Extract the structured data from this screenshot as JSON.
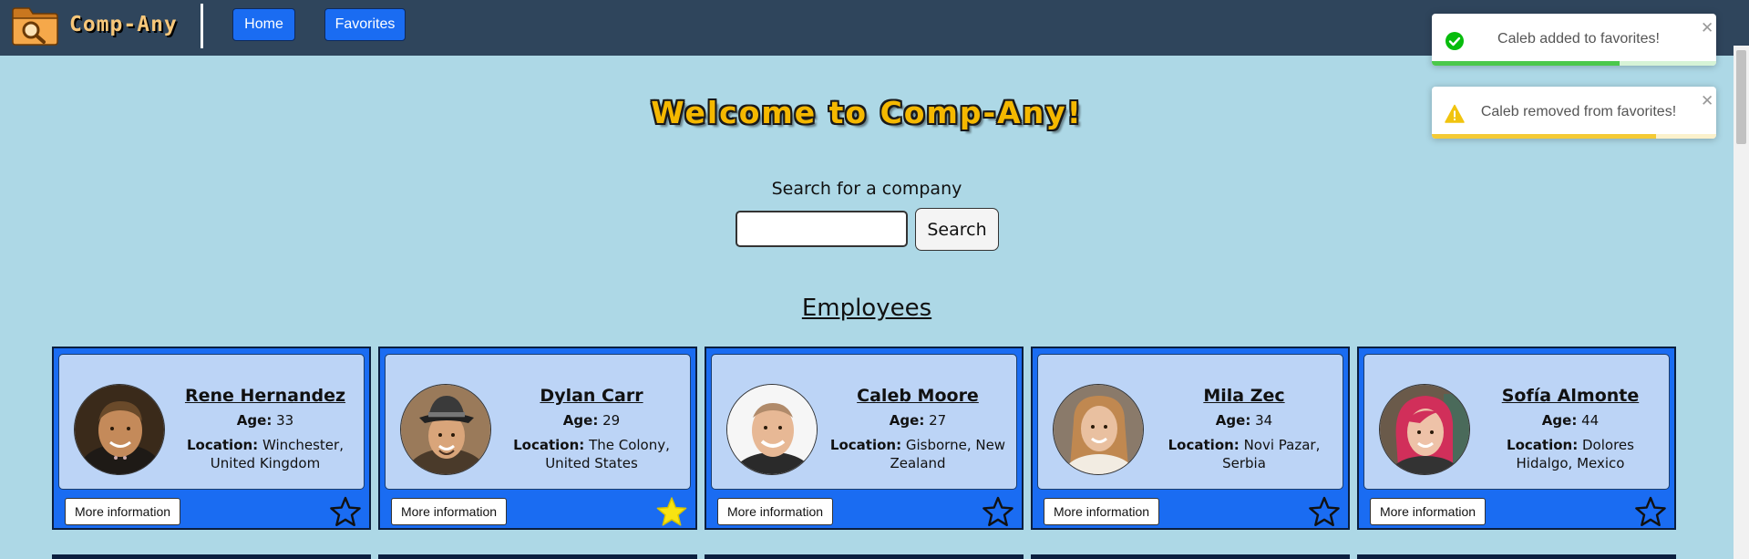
{
  "navbar": {
    "brand": "Comp-Any",
    "links": [
      {
        "label": "Home"
      },
      {
        "label": "Favorites"
      }
    ]
  },
  "main": {
    "welcome": "Welcome to Comp-Any!",
    "search_label": "Search for a company",
    "search_input_value": "",
    "search_button": "Search",
    "employees_heading": "Employees"
  },
  "employees": [
    {
      "name": "Rene Hernandez",
      "age_label": "Age:",
      "age": "33",
      "location_label": "Location:",
      "location": "Winchester, United Kingdom",
      "more_label": "More information",
      "favorite": false
    },
    {
      "name": "Dylan Carr",
      "age_label": "Age:",
      "age": "29",
      "location_label": "Location:",
      "location": "The Colony, United States",
      "more_label": "More information",
      "favorite": true
    },
    {
      "name": "Caleb Moore",
      "age_label": "Age:",
      "age": "27",
      "location_label": "Location:",
      "location": "Gisborne, New Zealand",
      "more_label": "More information",
      "favorite": false
    },
    {
      "name": "Mila Zec",
      "age_label": "Age:",
      "age": "34",
      "location_label": "Location:",
      "location": "Novi Pazar, Serbia",
      "more_label": "More information",
      "favorite": false
    },
    {
      "name": "Sofía Almonte",
      "age_label": "Age:",
      "age": "44",
      "location_label": "Location:",
      "location": "Dolores Hidalgo, Mexico",
      "more_label": "More information",
      "favorite": false
    }
  ],
  "toasts": [
    {
      "type": "success",
      "icon": "check-circle-icon",
      "message": "Caleb added to favorites!",
      "progress": 0.66,
      "color": "#4bc84b"
    },
    {
      "type": "warning",
      "icon": "warning-icon",
      "message": "Caleb removed from favorites!",
      "progress": 0.79,
      "color": "#f4ca35"
    }
  ],
  "colors": {
    "navbar": "#2f455c",
    "background": "#add8e6",
    "accent_blue": "#1a6cf2",
    "card_inner": "#bcd4f6",
    "star_active": "#f8e312",
    "title_yellow": "#f5b800"
  }
}
